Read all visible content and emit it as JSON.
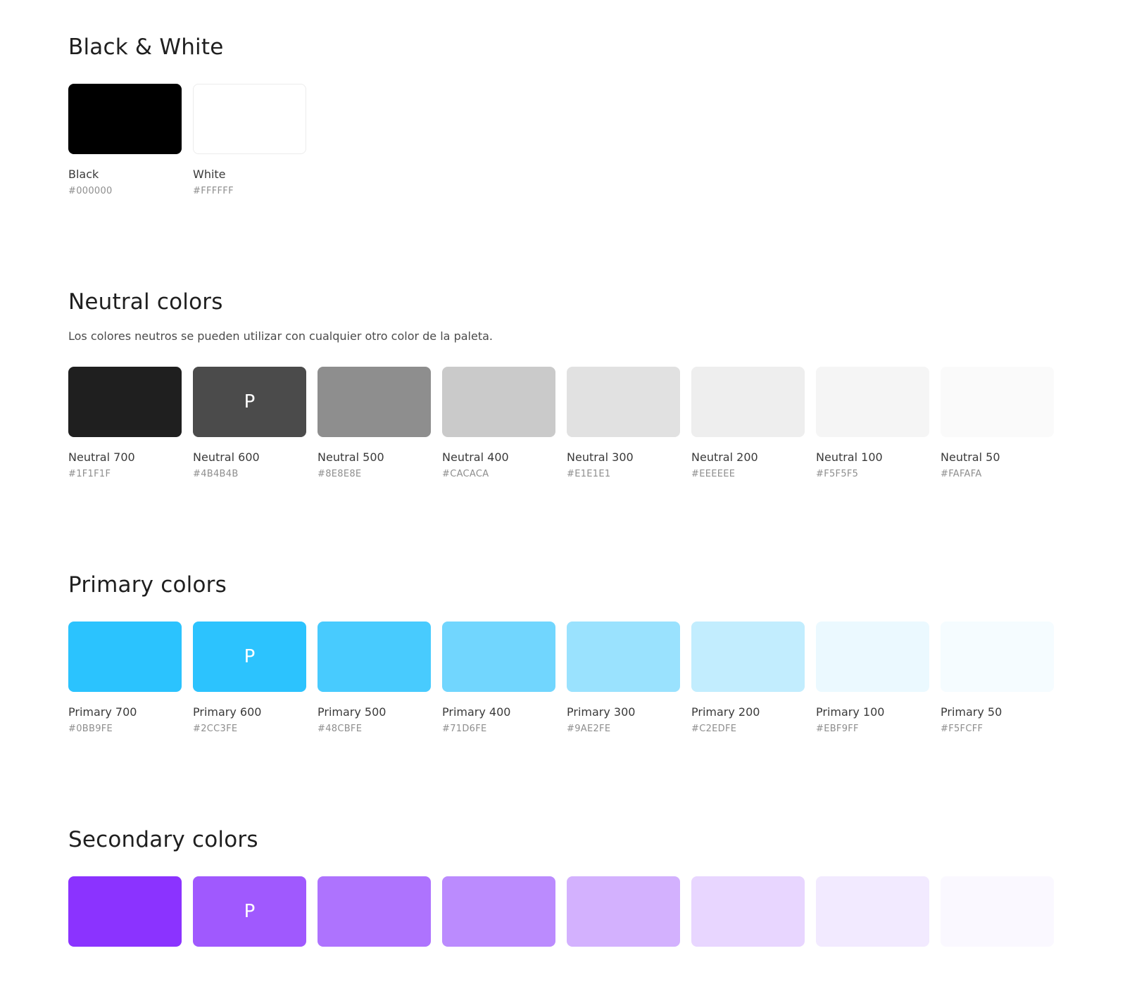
{
  "sections": [
    {
      "title": "Black & White",
      "description": "",
      "swatches": [
        {
          "name": "Black",
          "hex": "#000000",
          "color": "#000000",
          "letter": ""
        },
        {
          "name": "White",
          "hex": "#FFFFFF",
          "color": "#FFFFFF",
          "letter": ""
        }
      ]
    },
    {
      "title": "Neutral colors",
      "description": "Los colores neutros se pueden utilizar con cualquier otro color de la paleta.",
      "swatches": [
        {
          "name": "Neutral 700",
          "hex": "#1F1F1F",
          "color": "#1F1F1F",
          "letter": ""
        },
        {
          "name": "Neutral 600",
          "hex": "#4B4B4B",
          "color": "#4B4B4B",
          "letter": "P"
        },
        {
          "name": "Neutral 500",
          "hex": "#8E8E8E",
          "color": "#8E8E8E",
          "letter": ""
        },
        {
          "name": "Neutral 400",
          "hex": "#CACACA",
          "color": "#CACACA",
          "letter": ""
        },
        {
          "name": "Neutral 300",
          "hex": "#E1E1E1",
          "color": "#E1E1E1",
          "letter": ""
        },
        {
          "name": "Neutral 200",
          "hex": "#EEEEEE",
          "color": "#EEEEEE",
          "letter": ""
        },
        {
          "name": "Neutral 100",
          "hex": "#F5F5F5",
          "color": "#F5F5F5",
          "letter": ""
        },
        {
          "name": "Neutral 50",
          "hex": "#FAFAFA",
          "color": "#FAFAFA",
          "letter": ""
        }
      ]
    },
    {
      "title": "Primary colors",
      "description": "",
      "swatches": [
        {
          "name": "Primary 700",
          "hex": "#0BB9FE",
          "color": "#2BC3FE",
          "letter": ""
        },
        {
          "name": "Primary 600",
          "hex": "#2CC3FE",
          "color": "#2CC3FE",
          "letter": "P"
        },
        {
          "name": "Primary 500",
          "hex": "#48CBFE",
          "color": "#48CBFE",
          "letter": ""
        },
        {
          "name": "Primary 400",
          "hex": "#71D6FE",
          "color": "#71D6FE",
          "letter": ""
        },
        {
          "name": "Primary 300",
          "hex": "#9AE2FE",
          "color": "#9AE2FE",
          "letter": ""
        },
        {
          "name": "Primary 200",
          "hex": "#C2EDFE",
          "color": "#C2EDFE",
          "letter": ""
        },
        {
          "name": "Primary 100",
          "hex": "#EBF9FF",
          "color": "#EBF9FF",
          "letter": ""
        },
        {
          "name": "Primary 50",
          "hex": "#F5FCFF",
          "color": "#F5FCFF",
          "letter": ""
        }
      ]
    },
    {
      "title": "Secondary colors",
      "description": "",
      "swatches": [
        {
          "name": "",
          "hex": "",
          "color": "#8B33FF",
          "letter": ""
        },
        {
          "name": "",
          "hex": "",
          "color": "#A059FE",
          "letter": "P"
        },
        {
          "name": "",
          "hex": "",
          "color": "#AE73FE",
          "letter": ""
        },
        {
          "name": "",
          "hex": "",
          "color": "#BB8BFE",
          "letter": ""
        },
        {
          "name": "",
          "hex": "",
          "color": "#D3B1FE",
          "letter": ""
        },
        {
          "name": "",
          "hex": "",
          "color": "#E8D6FF",
          "letter": ""
        },
        {
          "name": "",
          "hex": "",
          "color": "#F2EAFF",
          "letter": ""
        },
        {
          "name": "",
          "hex": "",
          "color": "#FAF8FF",
          "letter": ""
        }
      ]
    }
  ]
}
